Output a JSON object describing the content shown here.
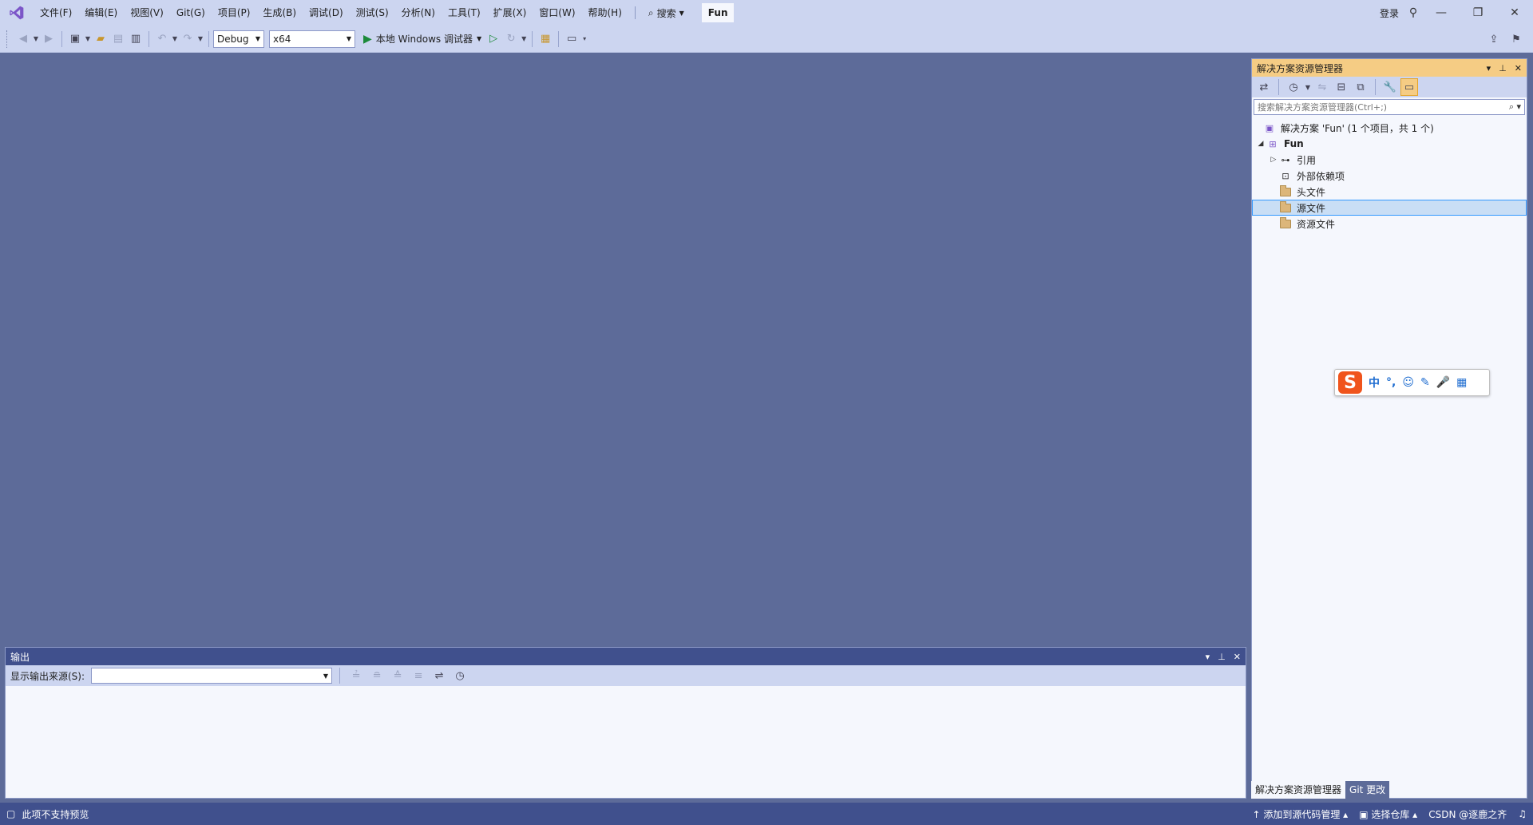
{
  "menu": {
    "items": [
      "文件(F)",
      "编辑(E)",
      "视图(V)",
      "Git(G)",
      "项目(P)",
      "生成(B)",
      "调试(D)",
      "测试(S)",
      "分析(N)",
      "工具(T)",
      "扩展(X)",
      "窗口(W)",
      "帮助(H)"
    ],
    "search_label": "搜索",
    "solution_name": "Fun",
    "login_label": "登录"
  },
  "toolbar": {
    "config": "Debug",
    "platform": "x64",
    "run_label": "本地 Windows 调试器"
  },
  "solution_explorer": {
    "title": "解决方案资源管理器",
    "search_placeholder": "搜索解决方案资源管理器(Ctrl+;)",
    "tree": {
      "solution": "解决方案 'Fun' (1 个项目，共 1 个)",
      "project": "Fun",
      "references": "引用",
      "external_deps": "外部依赖项",
      "header_files": "头文件",
      "source_files": "源文件",
      "resource_files": "资源文件"
    },
    "tabs": [
      "解决方案资源管理器",
      "Git 更改"
    ]
  },
  "output": {
    "title": "输出",
    "source_label": "显示输出来源(S):",
    "source_value": ""
  },
  "ime": {
    "logo": "S",
    "mode": "中"
  },
  "status": {
    "left": "此项不支持预览",
    "add_source_control": "添加到源代码管理",
    "select_repo": "选择仓库",
    "watermark": "CSDN @逐鹿之齐"
  },
  "colors": {
    "chrome": "#ccd5f0",
    "editor_bg": "#5d6b99",
    "panel_bg": "#f5f7fd",
    "active_title": "#f5cc84",
    "status_bar": "#40508d",
    "run_green": "#1c8a3a"
  }
}
